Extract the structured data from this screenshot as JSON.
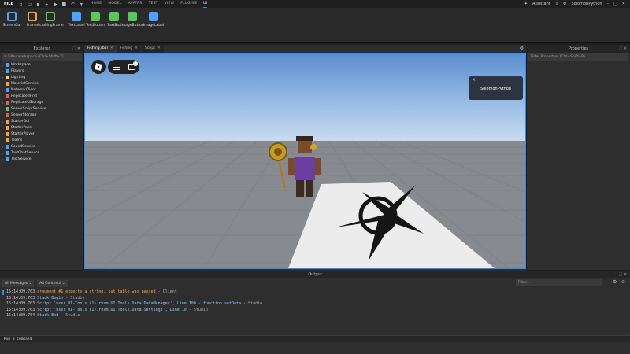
{
  "menubar": {
    "file": "FILE",
    "tabs": [
      "HOME",
      "MODEL",
      "AVATAR",
      "TEST",
      "VIEW",
      "PLUGINS",
      "UI"
    ],
    "active_tab": "UI",
    "assistant": "Assistant",
    "username": "SolomonPython"
  },
  "ribbon": {
    "items": [
      {
        "label": "ScreenGui",
        "icon": "screengui-icon",
        "color": "#4aa3ff"
      },
      {
        "label": "Frame",
        "icon": "frame-icon",
        "color": "#ff9f2e"
      },
      {
        "label": "ScrollingFrame",
        "icon": "scrollingframe-icon",
        "color": "#58c85a"
      },
      {
        "label": "TextLabel",
        "icon": "textlabel-icon",
        "color": "#4aa3ff"
      },
      {
        "label": "TextButton",
        "icon": "textbutton-icon",
        "color": "#58c85a"
      },
      {
        "label": "TextBox",
        "icon": "textbox-icon",
        "color": "#58c85a"
      },
      {
        "label": "ImageButton",
        "icon": "imagebutton-icon",
        "color": "#58c85a"
      },
      {
        "label": "ImageLabel",
        "icon": "imagelabel-icon",
        "color": "#4aa3ff"
      }
    ]
  },
  "explorer": {
    "title": "Explorer",
    "filter_placeholder": "Filter workspace (Ctrl+Shift+X)",
    "items": [
      {
        "label": "Workspace",
        "expandable": true,
        "color": "#4aa3ff"
      },
      {
        "label": "Players",
        "expandable": true,
        "color": "#4aa3ff"
      },
      {
        "label": "Lighting",
        "expandable": true,
        "color": "#ffd24a"
      },
      {
        "label": "MaterialService",
        "expandable": false,
        "color": "#ff9f2e"
      },
      {
        "label": "NetworkClient",
        "expandable": true,
        "color": "#4aa3ff"
      },
      {
        "label": "ReplicatedFirst",
        "expandable": false,
        "color": "#e85a5a"
      },
      {
        "label": "ReplicatedStorage",
        "expandable": true,
        "color": "#e85a5a"
      },
      {
        "label": "ServerScriptService",
        "expandable": false,
        "color": "#58c85a"
      },
      {
        "label": "ServerStorage",
        "expandable": false,
        "color": "#e85a5a"
      },
      {
        "label": "StarterGui",
        "expandable": true,
        "color": "#ff9f2e"
      },
      {
        "label": "StarterPack",
        "expandable": false,
        "color": "#ff9f2e"
      },
      {
        "label": "StarterPlayer",
        "expandable": true,
        "color": "#ff9f2e"
      },
      {
        "label": "Teams",
        "expandable": false,
        "color": "#ff9f2e"
      },
      {
        "label": "SoundService",
        "expandable": true,
        "color": "#4aa3ff"
      },
      {
        "label": "TextChatService",
        "expandable": true,
        "color": "#4aa3ff"
      },
      {
        "label": "TestService",
        "expandable": true,
        "color": "#4aa3ff"
      }
    ]
  },
  "editor": {
    "tabs": [
      {
        "label": "Fishing.rbxl",
        "active": true
      },
      {
        "label": "Fishing",
        "active": false
      },
      {
        "label": "Script",
        "active": false
      }
    ],
    "toast_name": "SolomonPython",
    "chat_badge": "1"
  },
  "properties": {
    "title": "Properties",
    "filter_placeholder": "Filter Properties (Ctrl+Shift+P)"
  },
  "output": {
    "title": "Output",
    "message_filter": "All Messages",
    "context_filter": "All Contexts",
    "filter_placeholder": "Filter...",
    "lines": [
      {
        "time": "16:14:09.703",
        "text": "argument #1 expects a string, but table was passed",
        "suffix": " - Client",
        "level": "warn"
      },
      {
        "time": "16:14:09.703",
        "text": "Stack Begin",
        "suffix": " - Studio",
        "level": "info"
      },
      {
        "time": "16:14:09.703",
        "text": "Script 'user_UI-Tools (1).rbxm.UI Tools.Data.DataManager', Line 100 - function setData",
        "suffix": " - Studio",
        "level": "info"
      },
      {
        "time": "16:14:09.703",
        "text": "Script 'user_UI-Tools (1).rbxm.UI Tools.Data.Settings', Line 10",
        "suffix": " - Studio",
        "level": "info"
      },
      {
        "time": "16:14:09.704",
        "text": "Stack End",
        "suffix": " - Studio",
        "level": "info"
      }
    ],
    "command_placeholder": "Run a command"
  },
  "colors": {
    "accent": "#2b8cff",
    "warning": "#ff9f2e",
    "info": "#8cc8ff"
  }
}
